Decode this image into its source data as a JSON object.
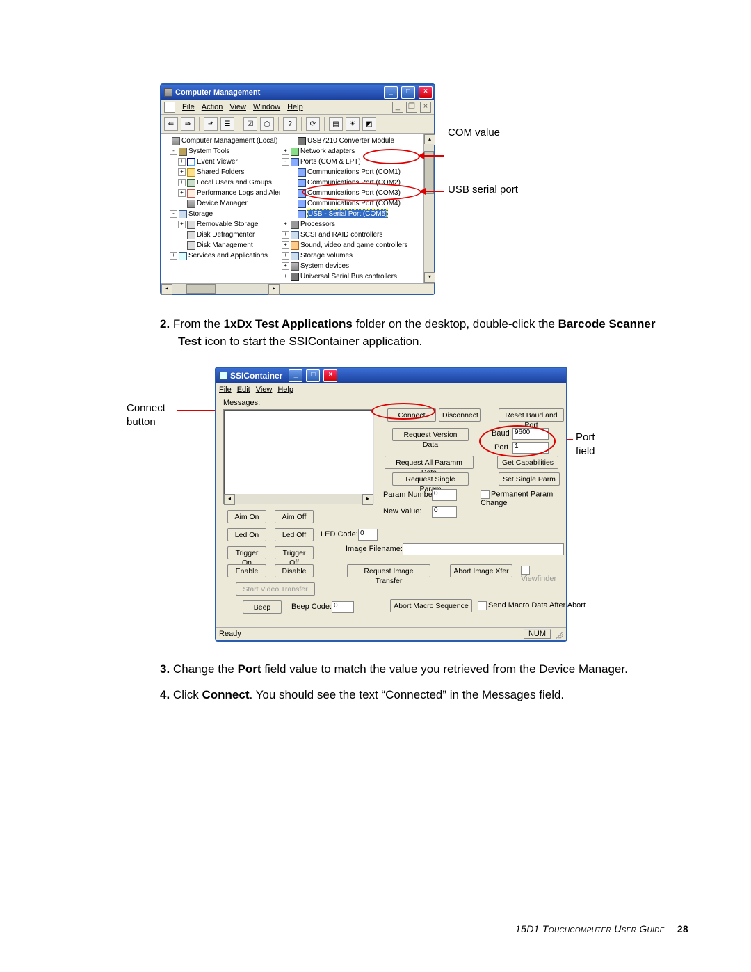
{
  "fig1": {
    "title": "Computer Management",
    "menus": [
      "File",
      "Action",
      "View",
      "Window",
      "Help"
    ],
    "left": [
      {
        "l": 0,
        "ex": "",
        "i": "ico-comp",
        "t": "Computer Management (Local)"
      },
      {
        "l": 1,
        "ex": "-",
        "i": "ico-tool",
        "t": "System Tools"
      },
      {
        "l": 2,
        "ex": "+",
        "i": "ico-mon",
        "t": "Event Viewer"
      },
      {
        "l": 2,
        "ex": "+",
        "i": "ico-fold",
        "t": "Shared Folders"
      },
      {
        "l": 2,
        "ex": "+",
        "i": "ico-users",
        "t": "Local Users and Groups"
      },
      {
        "l": 2,
        "ex": "+",
        "i": "ico-perf",
        "t": "Performance Logs and Alerts"
      },
      {
        "l": 2,
        "ex": "",
        "i": "ico-comp",
        "t": "Device Manager"
      },
      {
        "l": 1,
        "ex": "-",
        "i": "ico-stor",
        "t": "Storage"
      },
      {
        "l": 2,
        "ex": "+",
        "i": "ico-disk",
        "t": "Removable Storage"
      },
      {
        "l": 2,
        "ex": "",
        "i": "ico-disk",
        "t": "Disk Defragmenter"
      },
      {
        "l": 2,
        "ex": "",
        "i": "ico-disk",
        "t": "Disk Management"
      },
      {
        "l": 1,
        "ex": "+",
        "i": "ico-svc",
        "t": "Services and Applications"
      }
    ],
    "right": [
      {
        "l": 1,
        "ex": "",
        "i": "ico-usb",
        "t": "USB7210 Converter Module"
      },
      {
        "l": 0,
        "ex": "+",
        "i": "ico-net",
        "t": "Network adapters"
      },
      {
        "l": 0,
        "ex": "-",
        "i": "ico-port",
        "t": "Ports (COM & LPT)"
      },
      {
        "l": 1,
        "ex": "",
        "i": "ico-port",
        "t": "Communications Port (COM1)"
      },
      {
        "l": 1,
        "ex": "",
        "i": "ico-port",
        "t": "Communications Port (COM2)"
      },
      {
        "l": 1,
        "ex": "",
        "i": "ico-port",
        "t": "Communications Port (COM3)"
      },
      {
        "l": 1,
        "ex": "",
        "i": "ico-port",
        "t": "Communications Port (COM4)"
      },
      {
        "l": 1,
        "ex": "",
        "i": "ico-port",
        "t": "USB - Serial Port (COM5)",
        "hl": true
      },
      {
        "l": 0,
        "ex": "+",
        "i": "ico-proc",
        "t": "Processors"
      },
      {
        "l": 0,
        "ex": "+",
        "i": "ico-stor",
        "t": "SCSI and RAID controllers"
      },
      {
        "l": 0,
        "ex": "+",
        "i": "ico-snd",
        "t": "Sound, video and game controllers"
      },
      {
        "l": 0,
        "ex": "+",
        "i": "ico-stor",
        "t": "Storage volumes"
      },
      {
        "l": 0,
        "ex": "+",
        "i": "ico-comp",
        "t": "System devices"
      },
      {
        "l": 0,
        "ex": "+",
        "i": "ico-usb",
        "t": "Universal Serial Bus controllers"
      }
    ],
    "annot_com": "COM value",
    "annot_usb": "USB serial port"
  },
  "step2": {
    "num": "2.",
    "t1": "From the ",
    "b1": "1xDx Test Applications",
    "t2": " folder on the desktop, double-click the ",
    "b2": "Barcode Scanner Test",
    "t3": " icon to start the SSIContainer application."
  },
  "fig2": {
    "title": "SSIContainer",
    "menus": [
      "File",
      "Edit",
      "View",
      "Help"
    ],
    "messages_label": "Messages:",
    "btn_connect": "Connect",
    "btn_disconnect": "Disconnect",
    "btn_reset": "Reset Baud and Port",
    "btn_reqver": "Request Version Data",
    "lbl_baud": "Baud",
    "val_baud": "9600",
    "lbl_port": "Port",
    "val_port": "1",
    "btn_reqall": "Request All Paramm Data",
    "btn_getcap": "Get Capabilities",
    "btn_reqsingle": "Request Single Param",
    "btn_setsingle": "Set Single Parm",
    "lbl_paramnum": "Param Number:",
    "val_paramnum": "0",
    "chk_perm": "Permanent Param Change",
    "lbl_newval": "New Value:",
    "val_newval": "0",
    "btn_aimon": "Aim On",
    "btn_aimoff": "Aim Off",
    "btn_ledon": "Led On",
    "btn_ledoff": "Led Off",
    "lbl_ledcode": "LED Code:",
    "val_ledcode": "0",
    "btn_trigon": "Trigger On",
    "btn_trigoff": "Trigger Off",
    "lbl_imgfile": "Image Filename:",
    "btn_enable": "Enable",
    "btn_disable": "Disable",
    "btn_reqimg": "Request Image Transfer",
    "btn_abortimg": "Abort Image Xfer",
    "chk_view": "Viewfinder",
    "btn_startvid": "Start Video Transfer",
    "btn_beep": "Beep",
    "lbl_beepcode": "Beep Code:",
    "val_beepcode": "0",
    "btn_abortmacro": "Abort Macro Sequence",
    "chk_sendmacro": "Send Macro Data After Abort",
    "status_ready": "Ready",
    "status_num": "NUM",
    "annot_connect": "Connect button",
    "annot_port": "Port field"
  },
  "step3": {
    "num": "3.",
    "t1": "Change the ",
    "b1": "Port",
    "t2": " field value to match the value you retrieved from the Device Manager."
  },
  "step4": {
    "num": "4.",
    "t1": "Click ",
    "b1": "Connect",
    "t2": ". You should see the text “Connected” in the Messages field."
  },
  "footer": {
    "title_caps": "15D1 T﻿ouchcomputer U﻿ser G﻿uide",
    "page": "28"
  }
}
